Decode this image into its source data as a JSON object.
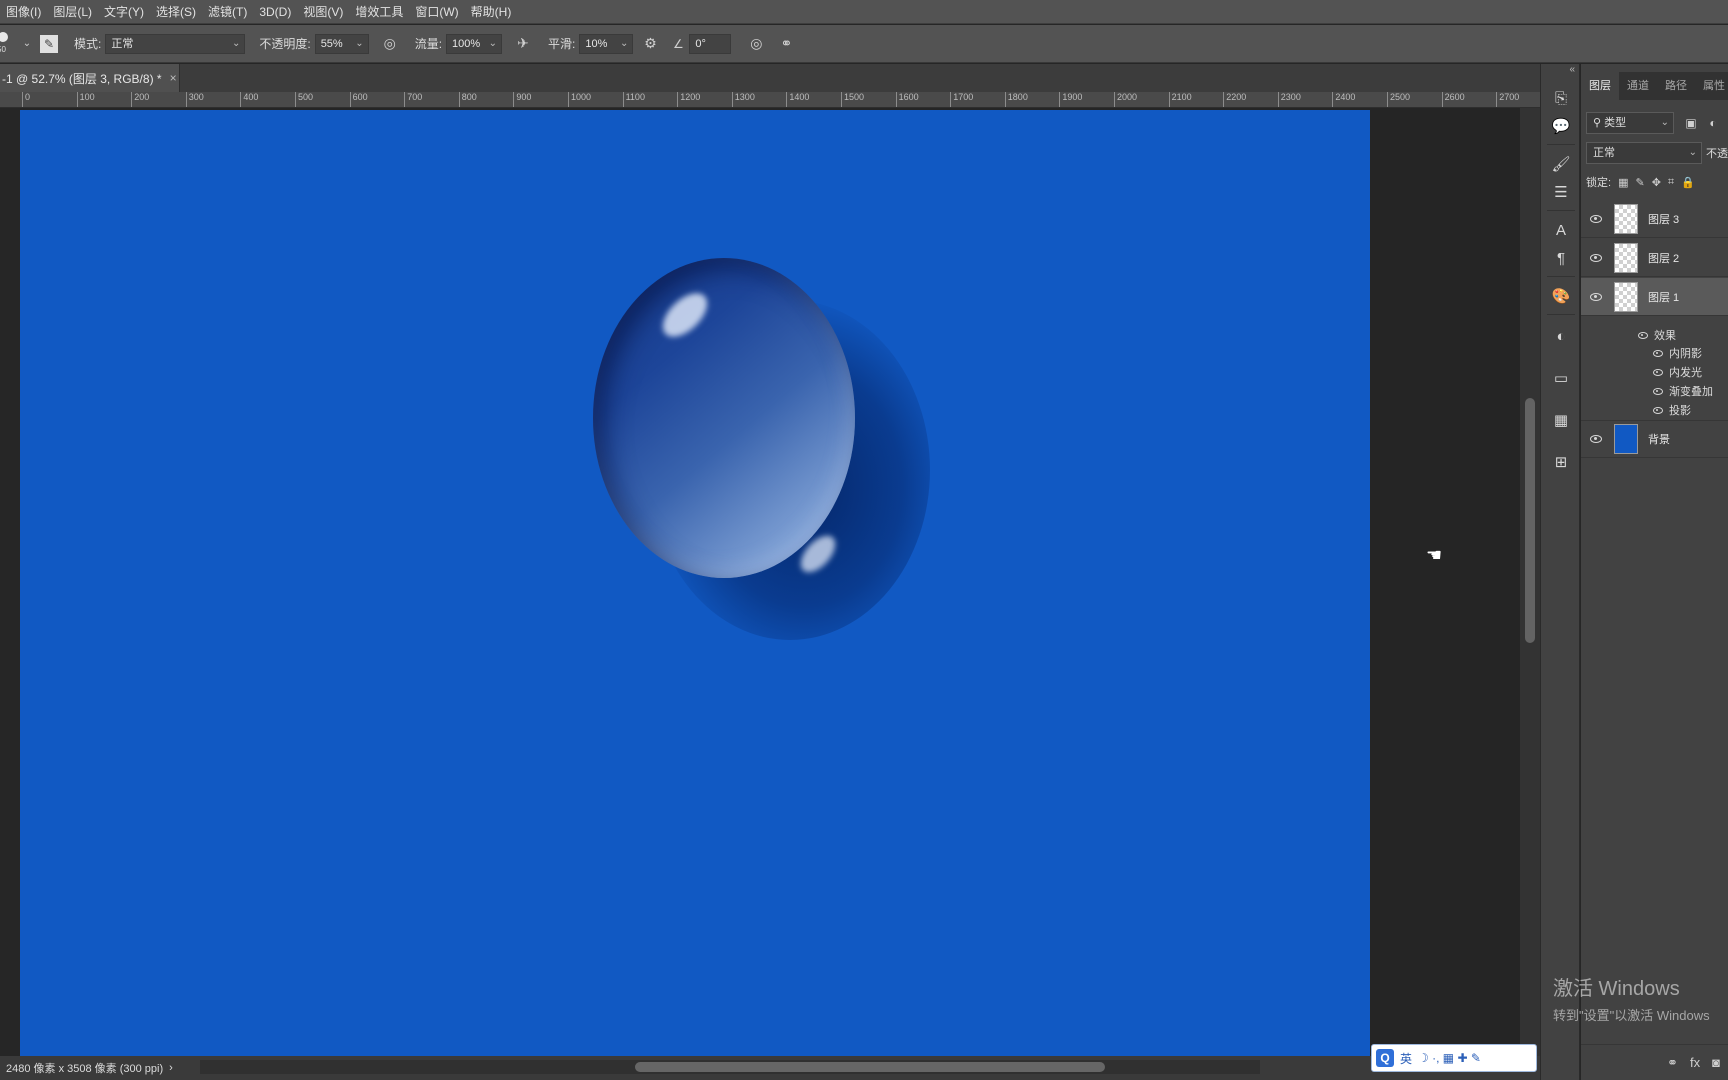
{
  "menubar": {
    "items": [
      "图像(I)",
      "图层(L)",
      "文字(Y)",
      "选择(S)",
      "滤镜(T)",
      "3D(D)",
      "视图(V)",
      "增效工具",
      "窗口(W)",
      "帮助(H)"
    ]
  },
  "options": {
    "brush_size": "50",
    "mode_label": "模式:",
    "mode_value": "正常",
    "opacity_label": "不透明度:",
    "opacity_value": "55%",
    "flow_label": "流量:",
    "flow_value": "100%",
    "smooth_label": "平滑:",
    "smooth_value": "10%",
    "angle_value": "0°"
  },
  "document": {
    "tab_title": "-1 @ 52.7% (图层 3, RGB/8) *",
    "close": "×"
  },
  "ruler": {
    "ticks": [
      "0",
      "100",
      "200",
      "300",
      "400",
      "500",
      "600",
      "700",
      "800",
      "900",
      "1000",
      "1100",
      "1200",
      "1300",
      "1400",
      "1500",
      "1600",
      "1700",
      "1800",
      "1900",
      "2000",
      "2100",
      "2200",
      "2300",
      "2400",
      "2500",
      "2600",
      "2700"
    ]
  },
  "status": {
    "doc_info": "2480 像素 x 3508 像素 (300 ppi)",
    "arrow": "›"
  },
  "ime": {
    "logo": "Q",
    "lang": "英",
    "icons": "☽ ·, ▦ ✚ ✎"
  },
  "layers_panel": {
    "tabs": [
      "图层",
      "通道",
      "路径",
      "属性"
    ],
    "filter_label": "类型",
    "blend_mode": "正常",
    "opacity_short": "不透",
    "lock_label": "锁定:",
    "layers": [
      {
        "name": "图层 3",
        "thumb": "transparent",
        "selected": false
      },
      {
        "name": "图层 2",
        "thumb": "transparent",
        "selected": false
      },
      {
        "name": "图层 1",
        "thumb": "transparent",
        "selected": true
      },
      {
        "name": "背景",
        "thumb": "blue",
        "selected": false
      }
    ],
    "effects_header": "效果",
    "effects": [
      "内阴影",
      "内发光",
      "渐变叠加",
      "投影"
    ]
  },
  "watermark": {
    "line1": "激活 Windows",
    "line2": "转到\"设置\"以激活 Windows"
  },
  "colors": {
    "canvas": "#1159c3",
    "accent": "#2f6fd8"
  }
}
